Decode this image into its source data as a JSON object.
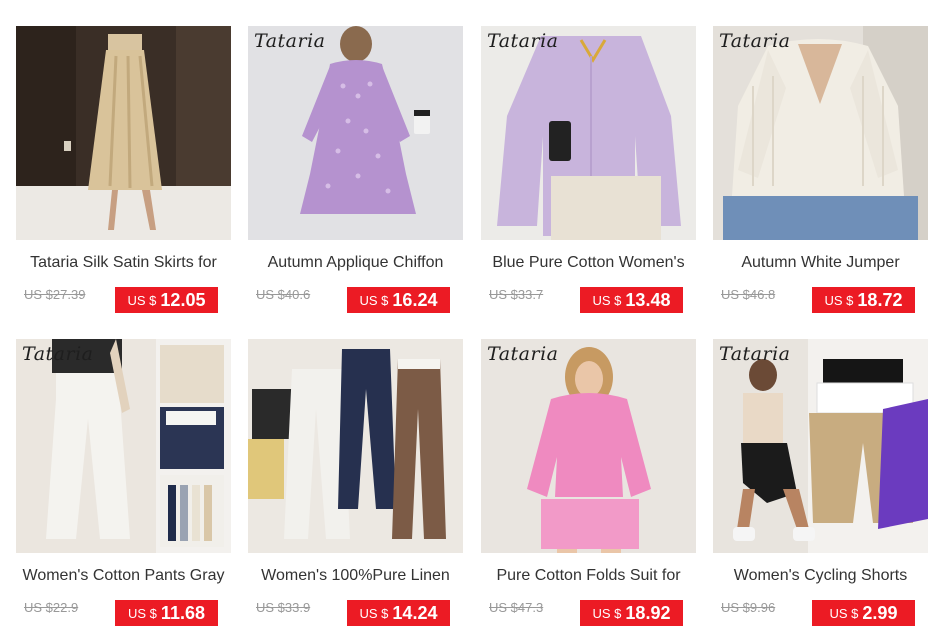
{
  "products": [
    {
      "title": "Tataria Silk Satin Skirts for",
      "brand_mark": "",
      "original_price": "US $27.39",
      "currency": "US $",
      "price": "12.05",
      "image": "gold-satin-skirt"
    },
    {
      "title": "Autumn Applique Chiffon",
      "brand_mark": "Tataria",
      "original_price": "US $40.6",
      "currency": "US $",
      "price": "16.24",
      "image": "lilac-chiffon-dress"
    },
    {
      "title": "Blue Pure Cotton Women's",
      "brand_mark": "Tataria",
      "original_price": "US $33.7",
      "currency": "US $",
      "price": "13.48",
      "image": "lavender-shirt"
    },
    {
      "title": "Autumn White Jumper",
      "brand_mark": "Tataria",
      "original_price": "US $46.8",
      "currency": "US $",
      "price": "18.72",
      "image": "white-knit-jumper"
    },
    {
      "title": "Women's Cotton Pants Gray",
      "brand_mark": "Tataria",
      "original_price": "US $22.9",
      "currency": "US $",
      "price": "11.68",
      "image": "white-wide-pants"
    },
    {
      "title": "Women's 100%Pure Linen",
      "brand_mark": "",
      "original_price": "US $33.9",
      "currency": "US $",
      "price": "14.24",
      "image": "linen-pants-flatlay"
    },
    {
      "title": "Pure Cotton Folds Suit for",
      "brand_mark": "Tataria",
      "original_price": "US $47.3",
      "currency": "US $",
      "price": "18.92",
      "image": "pink-shirt-shorts-set"
    },
    {
      "title": "Women's Cycling Shorts",
      "brand_mark": "Tataria",
      "original_price": "US $9.96",
      "currency": "US $",
      "price": "2.99",
      "image": "cycling-shorts"
    }
  ],
  "colors": {
    "price_badge": "#ec1b24",
    "old_price": "#999999",
    "title": "#333333"
  }
}
